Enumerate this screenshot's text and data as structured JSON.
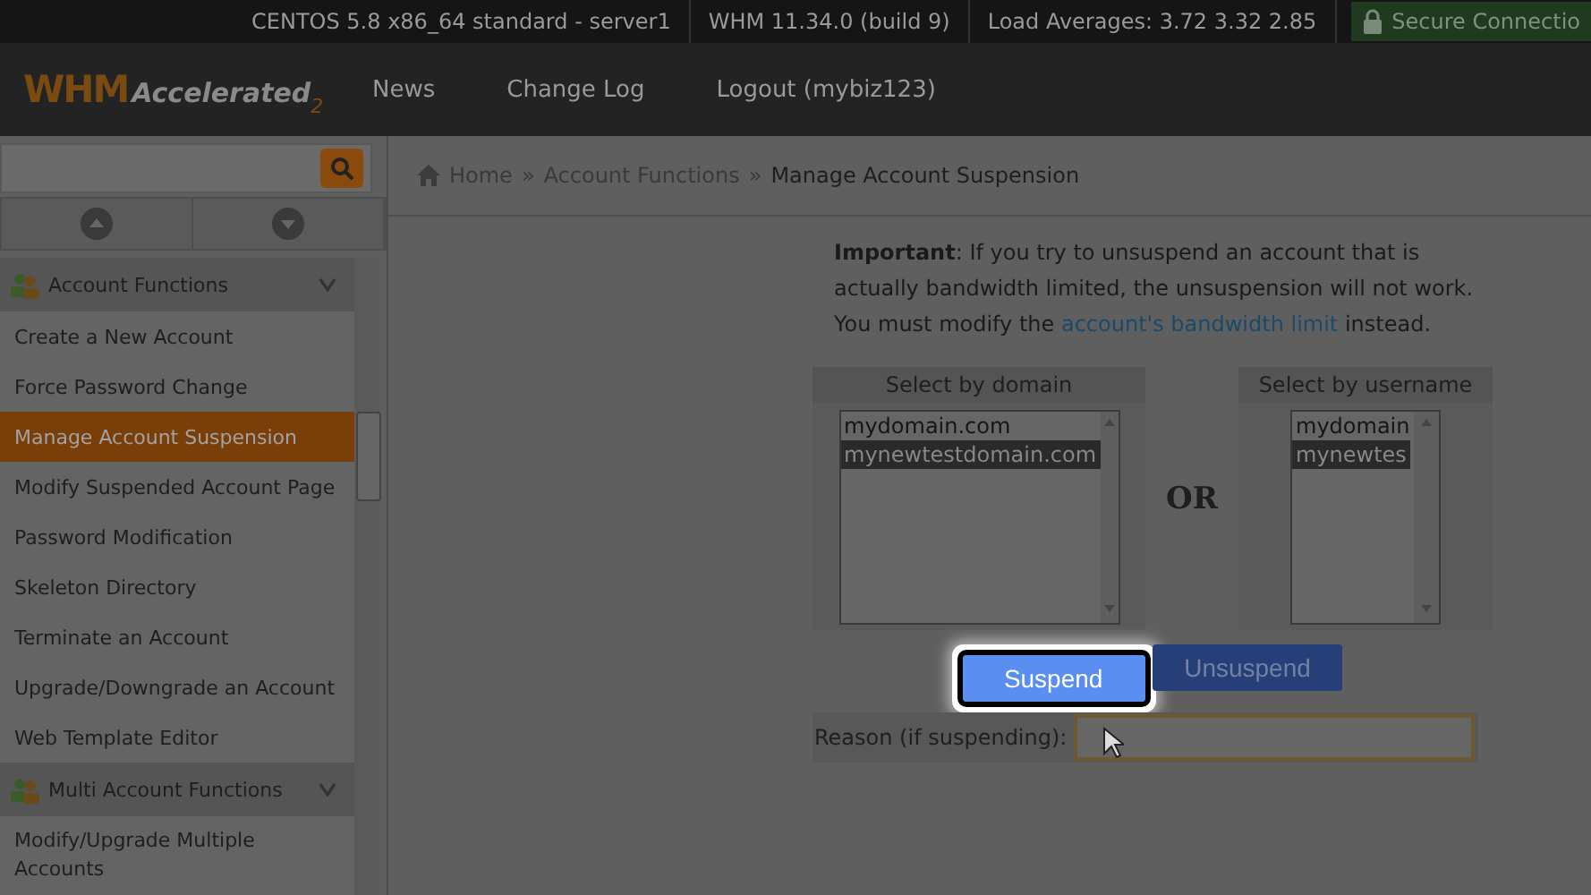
{
  "top_bar": {
    "items": [
      "CENTOS 5.8 x86_64 standard - server1",
      "WHM 11.34.0 (build 9)",
      "Load Averages: 3.72 3.32 2.85"
    ],
    "secure": "Secure Connectio"
  },
  "logo": {
    "main": "WHM",
    "script": "Accelerated",
    "version": "2"
  },
  "nav": [
    "News",
    "Change Log",
    "Logout (mybiz123)"
  ],
  "breadcrumb": {
    "items": [
      "Home",
      "Account Functions",
      "Manage Account Suspension"
    ],
    "separator": "»"
  },
  "sidebar": {
    "sections": [
      {
        "title": "Account Functions",
        "items": [
          {
            "label": "Create a New Account",
            "selected": false
          },
          {
            "label": "Force Password Change",
            "selected": false
          },
          {
            "label": "Manage Account Suspension",
            "selected": true
          },
          {
            "label": "Modify Suspended Account Page",
            "selected": false
          },
          {
            "label": "Password Modification",
            "selected": false
          },
          {
            "label": "Skeleton Directory",
            "selected": false
          },
          {
            "label": "Terminate an Account",
            "selected": false
          },
          {
            "label": "Upgrade/Downgrade an Account",
            "selected": false
          },
          {
            "label": "Web Template Editor",
            "selected": false
          }
        ]
      },
      {
        "title": "Multi Account Functions",
        "items": [
          {
            "label": "Modify/Upgrade Multiple Accounts",
            "selected": false
          }
        ]
      }
    ]
  },
  "notice": {
    "lead": "Important",
    "text": ": If you try to unsuspend an account that is actually bandwidth limited, the unsuspension will not work. You must modify the ",
    "link": "account's bandwidth limit",
    "tail": " instead."
  },
  "by_domain": {
    "heading": "Select by domain",
    "options": [
      {
        "label": "mydomain.com",
        "selected": false
      },
      {
        "label": "mynewtestdomain.com",
        "selected": true
      }
    ]
  },
  "or": "OR",
  "by_username": {
    "heading": "Select by username",
    "options": [
      {
        "label": "mydomain",
        "selected": false
      },
      {
        "label": "mynewtes",
        "selected": true
      }
    ]
  },
  "buttons": [
    {
      "label": "Suspend",
      "highlighted": true
    },
    {
      "label": "Unsuspend",
      "highlighted": false
    }
  ],
  "reason": {
    "label": "Reason (if suspending):"
  }
}
